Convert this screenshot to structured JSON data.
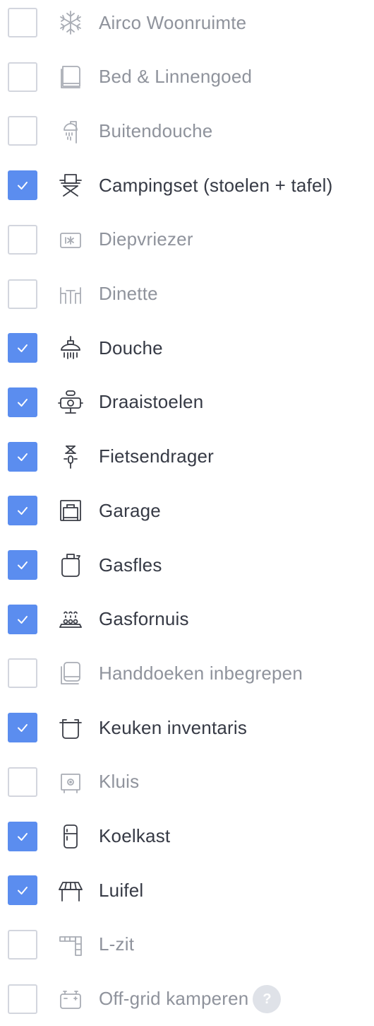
{
  "amenities": [
    {
      "label": "Airco Woonruimte",
      "checked": false,
      "icon": "snowflake-icon"
    },
    {
      "label": "Bed & Linnengoed",
      "checked": false,
      "icon": "bed-linen-icon"
    },
    {
      "label": "Buitendouche",
      "checked": false,
      "icon": "outdoor-shower-icon"
    },
    {
      "label": "Campingset (stoelen + tafel)",
      "checked": true,
      "icon": "camping-chair-icon"
    },
    {
      "label": "Diepvriezer",
      "checked": false,
      "icon": "freezer-icon"
    },
    {
      "label": "Dinette",
      "checked": false,
      "icon": "dinette-icon"
    },
    {
      "label": "Douche",
      "checked": true,
      "icon": "shower-icon"
    },
    {
      "label": "Draaistoelen",
      "checked": true,
      "icon": "swivel-seat-icon"
    },
    {
      "label": "Fietsendrager",
      "checked": true,
      "icon": "bike-carrier-icon"
    },
    {
      "label": "Garage",
      "checked": true,
      "icon": "garage-icon"
    },
    {
      "label": "Gasfles",
      "checked": true,
      "icon": "gas-bottle-icon"
    },
    {
      "label": "Gasfornuis",
      "checked": true,
      "icon": "gas-stove-icon"
    },
    {
      "label": "Handdoeken inbegrepen",
      "checked": false,
      "icon": "towel-icon"
    },
    {
      "label": "Keuken inventaris",
      "checked": true,
      "icon": "cooking-pot-icon"
    },
    {
      "label": "Kluis",
      "checked": false,
      "icon": "safe-icon"
    },
    {
      "label": "Koelkast",
      "checked": true,
      "icon": "fridge-icon"
    },
    {
      "label": "Luifel",
      "checked": true,
      "icon": "awning-icon"
    },
    {
      "label": "L-zit",
      "checked": false,
      "icon": "l-seat-icon"
    },
    {
      "label": "Off-grid kamperen",
      "checked": false,
      "icon": "battery-icon",
      "help": "?"
    }
  ],
  "colors": {
    "checkbox_checked": "#5b8def",
    "checkbox_border": "#d3d6de",
    "label_active": "#363a45",
    "label_inactive": "#8f939c"
  }
}
